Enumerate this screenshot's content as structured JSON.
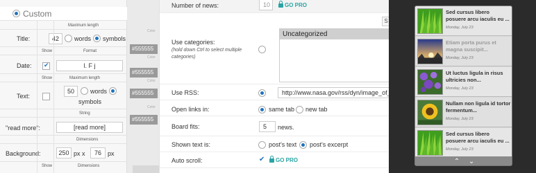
{
  "left": {
    "custom_label": "Custom",
    "max_length_header": "Maximum length",
    "title_label": "Title:",
    "title_value": "42",
    "words_label": "words",
    "symbols_label": "symbols",
    "show_header_1": "Show",
    "format_header": "Format",
    "date_label": "Date:",
    "date_format": "l. F j",
    "show_header_2": "Show",
    "max_length_header_2": "Maximum length",
    "text_label": "Text:",
    "text_value": "50",
    "words_label_2": "words",
    "symbols_label_2": "symbols",
    "string_header": "String",
    "read_more_label": "\"read more\":",
    "read_more_value": "[read more]",
    "dimensions_header": "Dimensions",
    "background_label": "Background:",
    "bg_width": "250",
    "bg_height": "76",
    "px_label": "px",
    "x_label": "x",
    "px_label_2": "px",
    "show_header_3": "Show",
    "dimensions_header_2": "Dimensions"
  },
  "col2": {
    "color_label": "Color",
    "rows": [
      {
        "color": "#555555"
      },
      {
        "color": "#555555"
      },
      {
        "color": "#555555"
      },
      {
        "color": "#555555"
      }
    ]
  },
  "panel": {
    "number_of_news_label": "Number of news:",
    "number_of_news_value": "10",
    "go_pro": "GO PRO",
    "use_categories_label": "Use categories:",
    "use_categories_hint": "(hold down Ctrl to select multiple categories)",
    "categories": [
      "Uncategorized"
    ],
    "s_button": "S",
    "use_rss_label": "Use RSS:",
    "rss_url": "http://www.nasa.gov/rss/dyn/image_of_t",
    "open_links_label": "Open links in:",
    "same_tab": "same tab",
    "new_tab": "new tab",
    "board_fits_label": "Board fits:",
    "board_fits_value": "5",
    "news_suffix": "news.",
    "shown_text_label": "Shown text is:",
    "posts_text": "post's text",
    "posts_excerpt": "post's excerpt",
    "auto_scroll_label": "Auto scroll:",
    "go_pro_2": "GO PRO"
  },
  "widget": {
    "items": [
      {
        "title": "Sed cursus libero posuere arcu iaculis eu ...",
        "date": "Monday, July 23",
        "thumb": "grass"
      },
      {
        "title": "Etiam porta purus et magna suscipit...",
        "date": "Monday, July 23",
        "thumb": "sunset"
      },
      {
        "title": "Ut luctus ligula in risus ultricies non...",
        "date": "Monday, July 23",
        "thumb": "flowers"
      },
      {
        "title": "Nullam non ligula id tortor fermentum...",
        "date": "Monday, July 23",
        "thumb": "sunflower"
      },
      {
        "title": "Sed cursus libero posuere arcu iaculis eu ...",
        "date": "Monday, July 23",
        "thumb": "grass"
      }
    ],
    "nav_up": "⌃",
    "nav_down": "⌄"
  },
  "colors": {
    "accent": "#1e73be",
    "go_pro": "#2aa4a4",
    "overlay": "#2b2b2b",
    "color_swatch": "#9a9a9a"
  }
}
